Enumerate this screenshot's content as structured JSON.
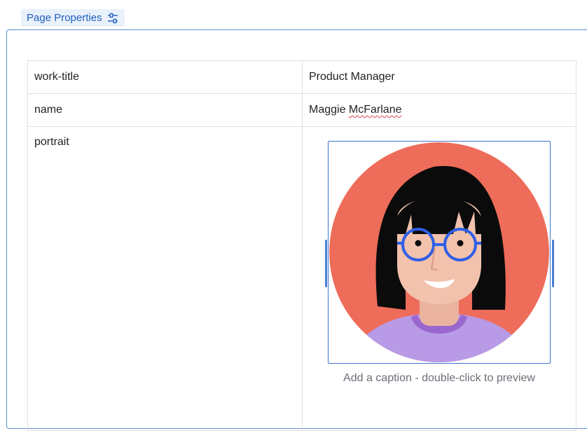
{
  "header": {
    "page_properties_label": "Page Properties",
    "icon": "sliders-icon"
  },
  "properties": [
    {
      "key": "work-title",
      "value": "Product Manager"
    },
    {
      "key": "name",
      "value": "Maggie McFarlane"
    },
    {
      "key": "portrait",
      "value": ""
    }
  ],
  "portrait": {
    "caption_placeholder": "Add a caption - double-click to preview",
    "image_icon": "avatar-illustration",
    "colors": {
      "background": "#ee6c5a",
      "hair": "#0b0b0b",
      "skin": "#f2c2ad",
      "shirt": "#b89ae6",
      "collar": "#9a67cf",
      "glasses": "#2f5fe6"
    }
  },
  "colors": {
    "accent": "#1f5fbf",
    "frame_border": "#5a8fd6",
    "tab_bg": "#e9f1fb"
  }
}
